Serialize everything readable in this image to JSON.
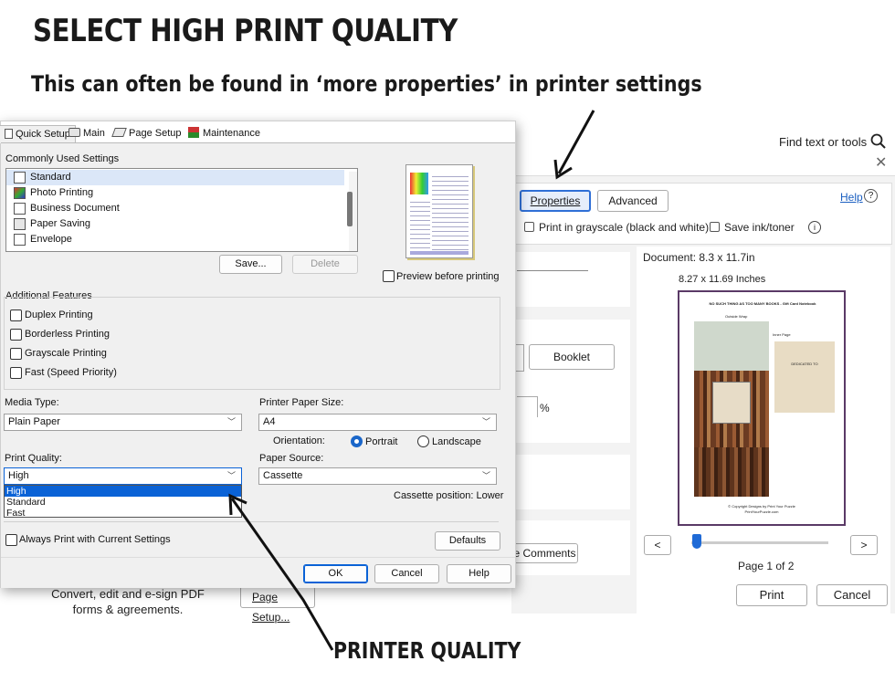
{
  "headline": "SELECT HIGH PRINT QUALITY",
  "subline": "This can often be found in ‘more properties’ in printer settings",
  "callout": "PRINTER QUALITY",
  "acrobat": {
    "find_text": "Find text or tools",
    "properties_button": "Properties",
    "advanced_button": "Advanced",
    "help_link": "Help",
    "grayscale_label": "Print in grayscale (black and white)",
    "save_ink_label": "Save ink/toner",
    "booklet_button": "Booklet",
    "percent": "%",
    "comments_button": "e Comments",
    "document_size": "Document: 8.3 x 11.7in",
    "page_size": "8.27 x 11.69 Inches",
    "page_label": "Page 1 of 2",
    "prev": "<",
    "next": ">",
    "print_button": "Print",
    "cancel_button": "Cancel",
    "page_setup_button": "Page Setup...",
    "convert_text": "Convert, edit and e-sign PDF forms & agreements."
  },
  "driver": {
    "tabs": [
      "Quick Setup",
      "Main",
      "Page Setup",
      "Maintenance"
    ],
    "commonly_used_title": "Commonly Used Settings",
    "settings": [
      "Standard",
      "Photo Printing",
      "Business Document",
      "Paper Saving",
      "Envelope"
    ],
    "save_button": "Save...",
    "delete_button": "Delete",
    "preview_label": "Preview before printing",
    "additional_title": "Additional Features",
    "features": [
      "Duplex Printing",
      "Borderless Printing",
      "Grayscale Printing",
      "Fast (Speed Priority)"
    ],
    "media_type_label": "Media Type:",
    "media_type_value": "Plain Paper",
    "paper_size_label": "Printer Paper Size:",
    "paper_size_value": "A4",
    "orientation_label": "Orientation:",
    "portrait": "Portrait",
    "landscape": "Landscape",
    "print_quality_label": "Print Quality:",
    "print_quality_value": "High",
    "quality_options": [
      "High",
      "Standard",
      "Fast"
    ],
    "paper_source_label": "Paper Source:",
    "paper_source_value": "Cassette",
    "cassette_position": "Cassette position: Lower",
    "always_print_label": "Always Print with Current Settings",
    "defaults_button": "Defaults",
    "ok_button": "OK",
    "cancel_button": "Cancel",
    "help_button": "Help"
  },
  "preview_doc": {
    "title": "NO SUCH THING AS TOO MANY BOOKS - Gift Card Notebook",
    "outside": "Outside Wrap",
    "inner": "Inner Page",
    "dedicated": "DEDICATED TO",
    "copyright": "© Copyright Designs by Print Your Puzzle",
    "site": "PrintYourPuzzle.com"
  }
}
